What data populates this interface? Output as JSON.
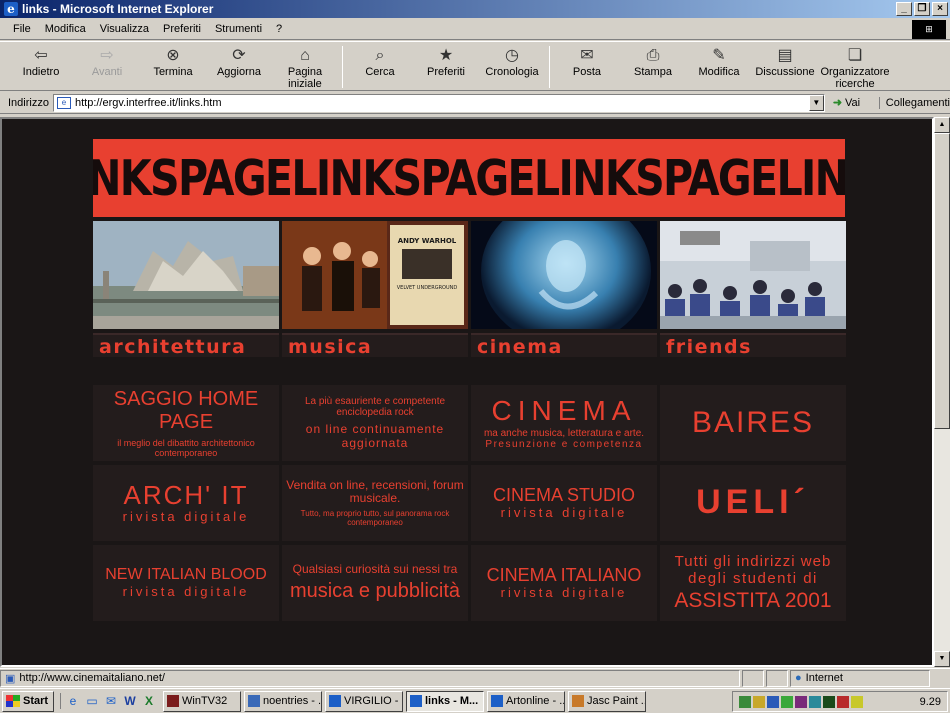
{
  "window": {
    "title": "links - Microsoft Internet Explorer"
  },
  "menu": [
    "File",
    "Modifica",
    "Visualizza",
    "Preferiti",
    "Strumenti",
    "?"
  ],
  "toolbar": {
    "back": "Indietro",
    "forward": "Avanti",
    "stop": "Termina",
    "refresh": "Aggiorna",
    "home_1": "Pagina",
    "home_2": "iniziale",
    "search": "Cerca",
    "favorites": "Preferiti",
    "history": "Cronologia",
    "mail": "Posta",
    "print": "Stampa",
    "edit": "Modifica",
    "discuss": "Discussione",
    "research_1": "Organizzatore",
    "research_2": "ricerche"
  },
  "address": {
    "label": "Indirizzo",
    "url": "http://ergv.interfree.it/links.htm",
    "go": "Vai",
    "links": "Collegamenti"
  },
  "page": {
    "banner": "NKSPAGELINKSPAGELINKSPAGELINKSPAG",
    "captions": [
      "architettura",
      "musica",
      "cinema",
      "friends"
    ],
    "cells": {
      "c1": {
        "title": "SAGGIO HOME PAGE",
        "sub": "il meglio del dibattito architettonico contemporaneo"
      },
      "c2": {
        "line1": "La più esauriente e competente enciclopedia rock",
        "line2": "on line continuamente aggiornata"
      },
      "c3": {
        "title": "CINEMA",
        "line1": "ma anche musica, letteratura e arte.",
        "line2": "Presunzione e competenza"
      },
      "c4": {
        "title": "BAIRES"
      },
      "c5": {
        "title": "ARCH' IT",
        "sub": "rivista digitale"
      },
      "c6": {
        "line1": "Vendita on line, recensioni, forum musicale.",
        "line2": "Tutto, ma proprio tutto, sul panorama rock contemporaneo"
      },
      "c7": {
        "title": "CINEMA STUDIO",
        "sub": "rivista digitale"
      },
      "c8": {
        "title": "UELI´"
      },
      "c9": {
        "title": "NEW ITALIAN BLOOD",
        "sub": "rivista digitale"
      },
      "c10": {
        "line1": "Qualsiasi curiosità sui nessi tra",
        "line2": "musica e pubblicità"
      },
      "c11": {
        "title": "CINEMA ITALIANO",
        "sub": "rivista digitale"
      },
      "c12": {
        "line1": "Tutti gli indirizzi web",
        "line2": "degli studenti di",
        "line3": "ASSISTITA 2001"
      }
    },
    "andy_text": "ANDY WARHOL",
    "velvet_text": "VELVET UNDERGROUND"
  },
  "status": {
    "url": "http://www.cinemaitaliano.net/",
    "zone": "Internet"
  },
  "taskbar": {
    "start": "Start",
    "tasks": [
      "WinTV32",
      "noentries - ...",
      "VIRGILIO - ...",
      "links - M...",
      "Artonline - ...",
      "Jasc Paint ..."
    ],
    "clock": "9.29"
  },
  "colors": {
    "accent": "#e84030",
    "page_bg": "#1a1616"
  }
}
